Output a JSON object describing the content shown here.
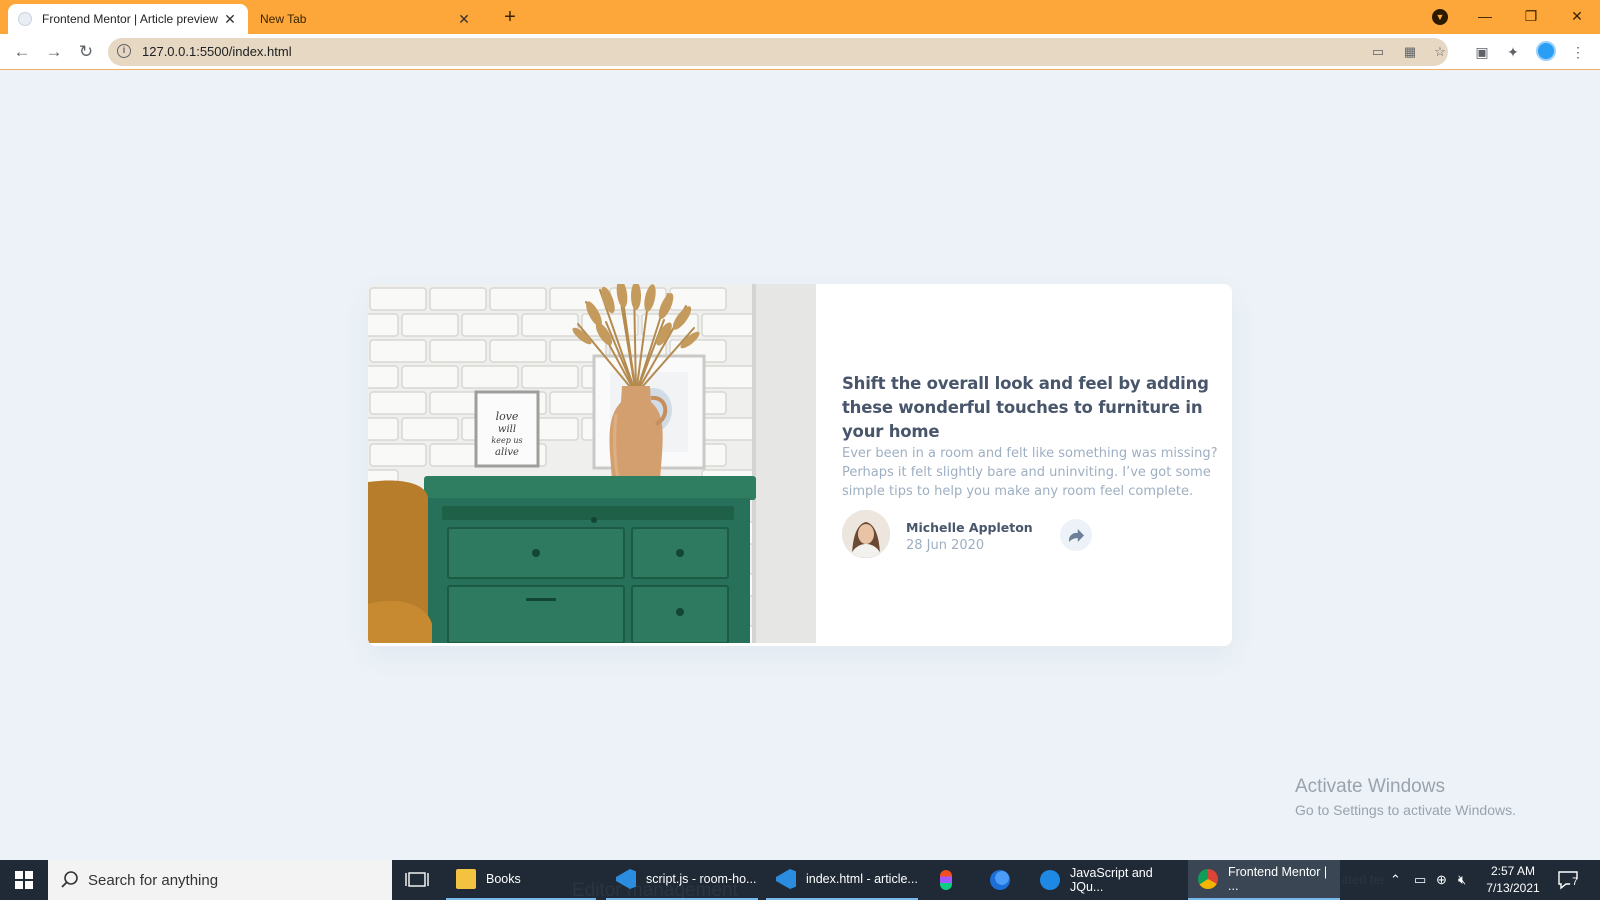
{
  "browser": {
    "tabs": [
      {
        "title": "Frontend Mentor | Article preview",
        "active": true
      },
      {
        "title": "New Tab",
        "active": false
      }
    ],
    "url": "127.0.0.1:5500/index.html",
    "accent_color": "#fda73a"
  },
  "card": {
    "headline": "Shift the overall look and feel by adding these wonderful touches to furniture in your home",
    "excerpt": "Ever been in a room and felt like something was missing? Perhaps it felt slightly bare and uninviting. I’ve got some simple tips to help you make any room feel complete.",
    "author_name": "Michelle Appleton",
    "author_date": "28 Jun 2020",
    "frame_text": "love will keep us alive",
    "colors": {
      "headline": "#48556a",
      "muted": "#9eafc2",
      "background": "#ecf2f8",
      "cabinet": "#2b7a5e"
    }
  },
  "watermark": {
    "title": "Activate Windows",
    "subtitle": "Go to Settings to activate Windows."
  },
  "taskbar": {
    "search_placeholder": "Search for anything",
    "apps": [
      {
        "label": "Books",
        "icon": "folder-icon"
      },
      {
        "label": "script.js - room-ho...",
        "icon": "vscode-icon"
      },
      {
        "label": "index.html - article...",
        "icon": "vscode-icon"
      },
      {
        "label": "",
        "icon": "figma-icon"
      },
      {
        "label": "",
        "icon": "firefox-icon"
      },
      {
        "label": "JavaScript and JQu...",
        "icon": "edge-icon"
      },
      {
        "label": "Frontend Mentor | ...",
        "icon": "chrome-icon"
      }
    ],
    "ghost_text": "Editor management",
    "ghost_text_2": "ated ter",
    "time": "2:57 AM",
    "date": "7/13/2021",
    "notification_count": "7"
  }
}
